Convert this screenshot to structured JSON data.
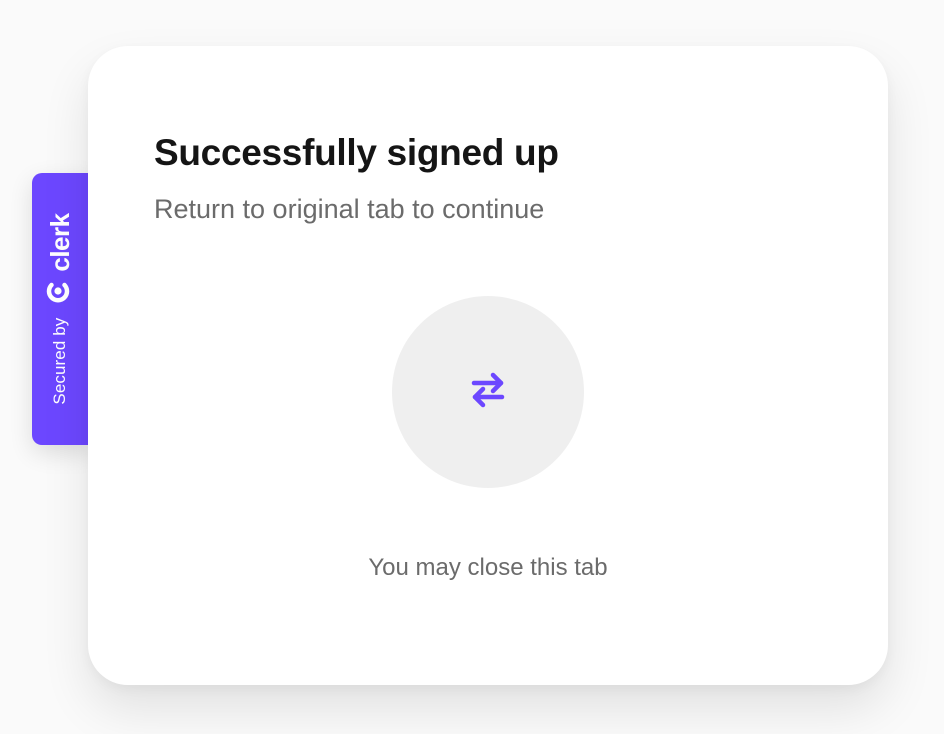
{
  "badge": {
    "secured_by": "Secured by",
    "brand": "clerk",
    "logo_icon": "clerk-logo-icon",
    "color": "#6c47ff"
  },
  "card": {
    "title": "Successfully signed up",
    "subtitle": "Return to original tab to continue",
    "icon": "switch-arrows-icon",
    "icon_color": "#6c47ff",
    "footnote": "You may close this tab"
  }
}
